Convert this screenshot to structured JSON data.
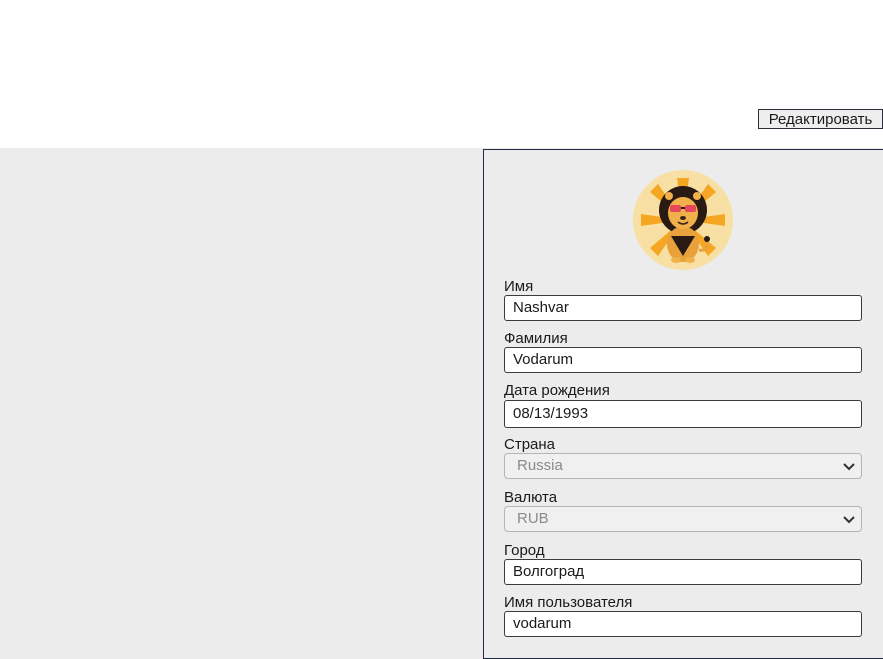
{
  "toolbar": {
    "edit_label": "Редактировать"
  },
  "profile": {
    "avatar_icon": "lion-with-sunglasses-icon",
    "fields": {
      "first_name": {
        "label": "Имя",
        "value": "Nashvar"
      },
      "last_name": {
        "label": "Фамилия",
        "value": "Vodarum"
      },
      "birth_date": {
        "label": "Дата рождения",
        "value": "08/13/1993"
      },
      "country": {
        "label": "Страна",
        "value": "Russia"
      },
      "currency": {
        "label": "Валюта",
        "value": "RUB"
      },
      "city": {
        "label": "Город",
        "value": "Волгоград"
      },
      "username": {
        "label": "Имя пользователя",
        "value": "vodarum"
      }
    }
  },
  "colors": {
    "page_background": "#ececec",
    "header_background": "#ffffff",
    "panel_border": "#1f2a44",
    "avatar_background": "#f8dfa3",
    "avatar_sun": "#f5a623"
  }
}
